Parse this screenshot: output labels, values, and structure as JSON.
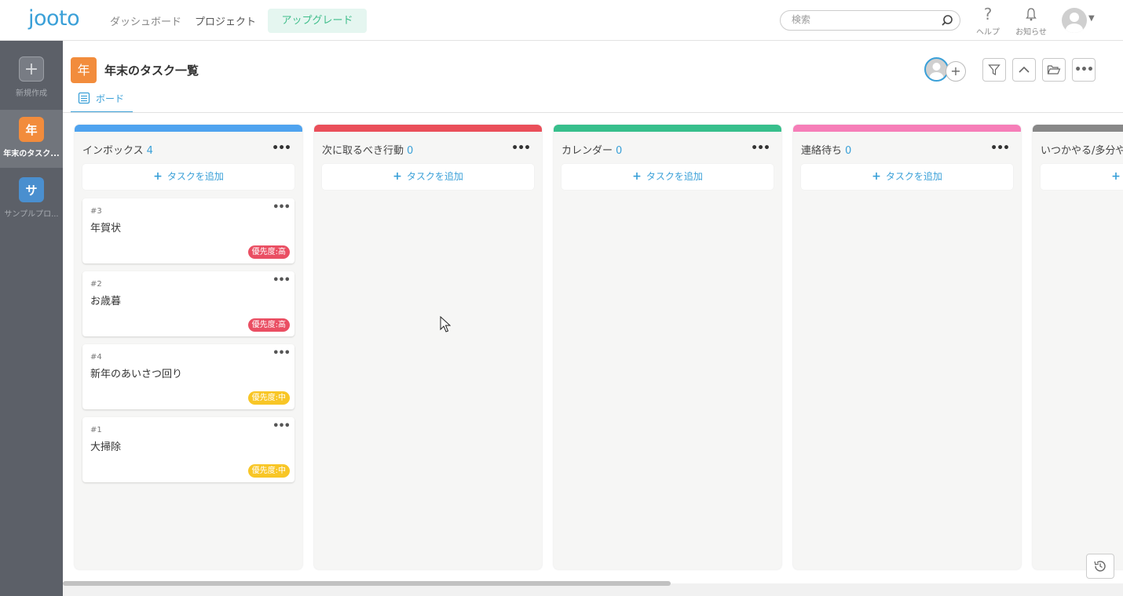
{
  "topbar": {
    "logo": "jooto",
    "nav": [
      "ダッシュボード",
      "プロジェクト"
    ],
    "upgrade": "アップグレード",
    "search_placeholder": "検索",
    "help_label": "ヘルプ",
    "notice_label": "お知らせ"
  },
  "sidebar": {
    "new_label": "新規作成",
    "projects": [
      {
        "initial": "年",
        "label": "年末のタスク...",
        "color": "#f28c3c",
        "active": true
      },
      {
        "initial": "サ",
        "label": "サンプルプロ...",
        "color": "#4a8fcf",
        "active": false
      }
    ]
  },
  "project": {
    "initial": "年",
    "title": "年末のタスク一覧",
    "tab": "ボード"
  },
  "board": {
    "add_task": "タスクを追加",
    "columns": [
      {
        "name": "インボックス",
        "count": "4",
        "color": "#4fa3ef"
      },
      {
        "name": "次に取るべき行動",
        "count": "0",
        "color": "#ea4f5a"
      },
      {
        "name": "カレンダー",
        "count": "0",
        "color": "#37bf8c"
      },
      {
        "name": "連絡待ち",
        "count": "0",
        "color": "#f67eb8"
      },
      {
        "name": "いつかやる/多分や",
        "count": "",
        "color": "#888888"
      }
    ],
    "cards": [
      {
        "num": "#3",
        "title": "年賀状",
        "priority": "優先度:高",
        "level": "high"
      },
      {
        "num": "#2",
        "title": "お歳暮",
        "priority": "優先度:高",
        "level": "high"
      },
      {
        "num": "#4",
        "title": "新年のあいさつ回り",
        "priority": "優先度:中",
        "level": "mid"
      },
      {
        "num": "#1",
        "title": "大掃除",
        "priority": "優先度:中",
        "level": "mid"
      }
    ]
  }
}
